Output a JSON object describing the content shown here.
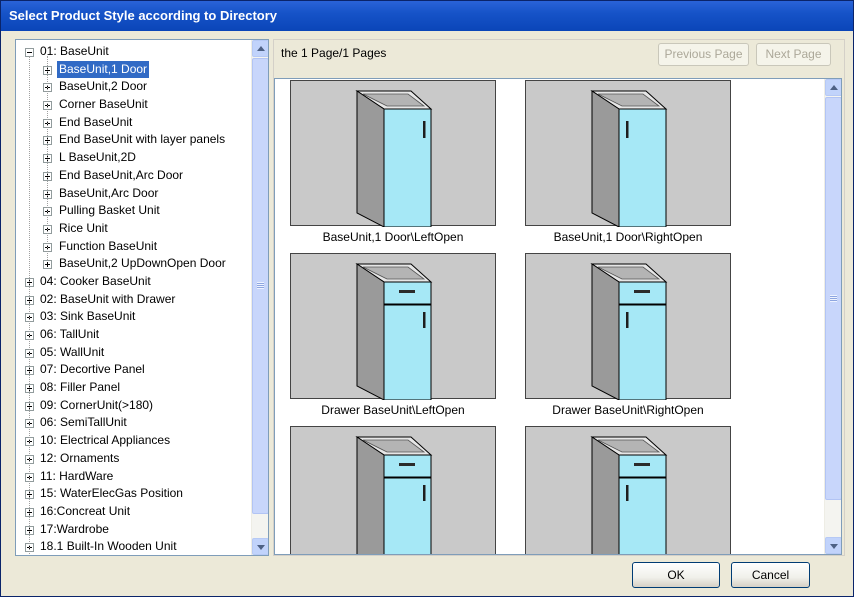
{
  "window": {
    "title": "Select Product Style according to  Directory"
  },
  "tree": {
    "items": [
      {
        "label": "01: BaseUnit",
        "level": 0,
        "expanded": true,
        "selected": false
      },
      {
        "label": "BaseUnit,1 Door",
        "level": 1,
        "expanded": false,
        "selected": true
      },
      {
        "label": "BaseUnit,2 Door",
        "level": 1,
        "expanded": false,
        "selected": false
      },
      {
        "label": "Corner BaseUnit",
        "level": 1,
        "expanded": false,
        "selected": false
      },
      {
        "label": "End BaseUnit",
        "level": 1,
        "expanded": false,
        "selected": false
      },
      {
        "label": "End BaseUnit with layer panels",
        "level": 1,
        "expanded": false,
        "selected": false
      },
      {
        "label": "L BaseUnit,2D",
        "level": 1,
        "expanded": false,
        "selected": false
      },
      {
        "label": "End BaseUnit,Arc Door",
        "level": 1,
        "expanded": false,
        "selected": false
      },
      {
        "label": "BaseUnit,Arc Door",
        "level": 1,
        "expanded": false,
        "selected": false
      },
      {
        "label": "Pulling Basket Unit",
        "level": 1,
        "expanded": false,
        "selected": false
      },
      {
        "label": "Rice Unit",
        "level": 1,
        "expanded": false,
        "selected": false
      },
      {
        "label": "Function BaseUnit",
        "level": 1,
        "expanded": false,
        "selected": false
      },
      {
        "label": "BaseUnit,2 UpDownOpen Door",
        "level": 1,
        "expanded": false,
        "selected": false
      },
      {
        "label": "04: Cooker BaseUnit",
        "level": 0,
        "expanded": false,
        "selected": false
      },
      {
        "label": "02: BaseUnit with Drawer",
        "level": 0,
        "expanded": false,
        "selected": false
      },
      {
        "label": "03: Sink BaseUnit",
        "level": 0,
        "expanded": false,
        "selected": false
      },
      {
        "label": "06: TallUnit",
        "level": 0,
        "expanded": false,
        "selected": false
      },
      {
        "label": "05: WallUnit",
        "level": 0,
        "expanded": false,
        "selected": false
      },
      {
        "label": "07: Decortive Panel",
        "level": 0,
        "expanded": false,
        "selected": false
      },
      {
        "label": "08: Filler Panel",
        "level": 0,
        "expanded": false,
        "selected": false
      },
      {
        "label": "09: CornerUnit(>180)",
        "level": 0,
        "expanded": false,
        "selected": false
      },
      {
        "label": "06: SemiTallUnit",
        "level": 0,
        "expanded": false,
        "selected": false
      },
      {
        "label": "10: Electrical Appliances",
        "level": 0,
        "expanded": false,
        "selected": false
      },
      {
        "label": "12: Ornaments",
        "level": 0,
        "expanded": false,
        "selected": false
      },
      {
        "label": "11: HardWare",
        "level": 0,
        "expanded": false,
        "selected": false
      },
      {
        "label": "15: WaterElecGas Position",
        "level": 0,
        "expanded": false,
        "selected": false
      },
      {
        "label": "16:Concreat Unit",
        "level": 0,
        "expanded": false,
        "selected": false
      },
      {
        "label": "17:Wardrobe",
        "level": 0,
        "expanded": false,
        "selected": false
      },
      {
        "label": "18.1 Built-In Wooden Unit",
        "level": 0,
        "expanded": false,
        "selected": false
      }
    ]
  },
  "pager": {
    "info": "the 1 Page/1 Pages",
    "previous_label": "Previous Page",
    "next_label": "Next Page"
  },
  "products": [
    {
      "caption": "BaseUnit,1 Door\\LeftOpen",
      "drawer": false,
      "handle": "right"
    },
    {
      "caption": "BaseUnit,1 Door\\RightOpen",
      "drawer": false,
      "handle": "left"
    },
    {
      "caption": "Drawer BaseUnit\\LeftOpen",
      "drawer": true,
      "handle": "right"
    },
    {
      "caption": "Drawer BaseUnit\\RightOpen",
      "drawer": true,
      "handle": "left"
    },
    {
      "caption": "",
      "drawer": true,
      "handle": "right"
    },
    {
      "caption": "",
      "drawer": true,
      "handle": "left"
    }
  ],
  "buttons": {
    "ok_label": "OK",
    "cancel_label": "Cancel"
  },
  "colors": {
    "title_bar": "#0a45b8",
    "selection": "#316ac5",
    "cabinet_front": "#a6e8f6",
    "cabinet_side": "#9a9a9a"
  }
}
